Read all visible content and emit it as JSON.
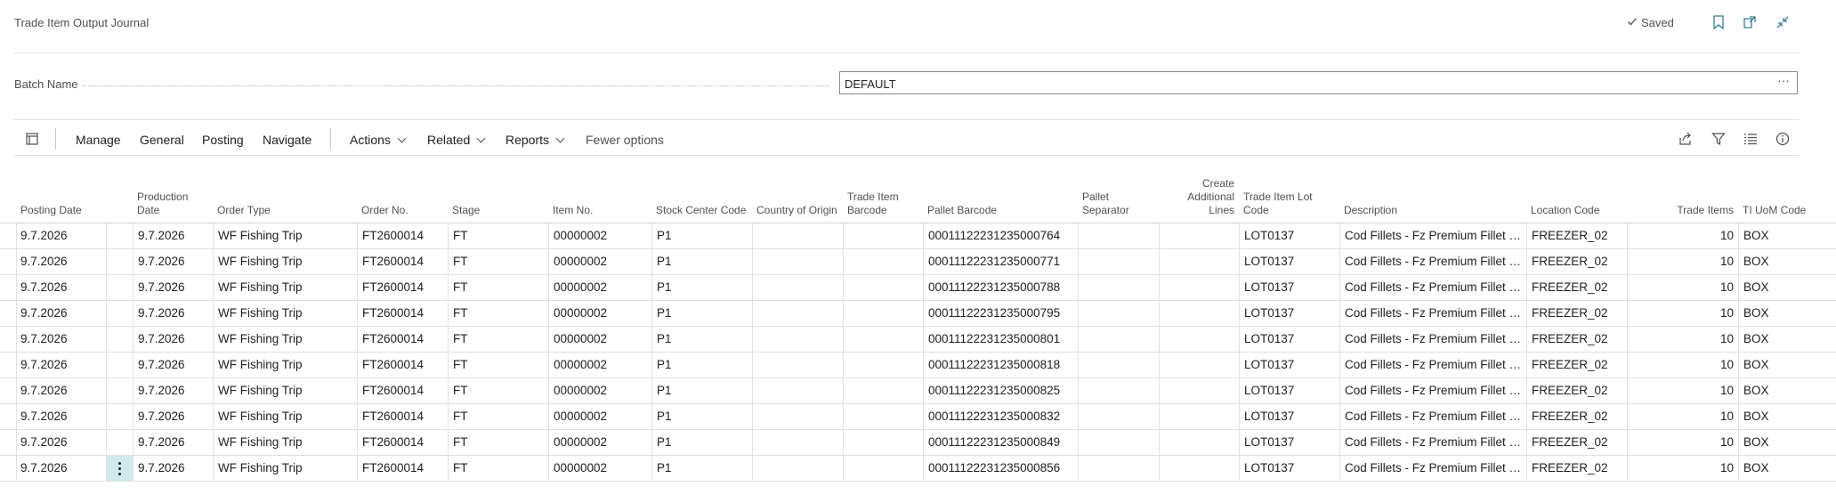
{
  "header": {
    "title": "Trade Item Output Journal",
    "saved_label": "Saved",
    "icons": [
      "checkmark-icon",
      "bookmark-icon",
      "open-in-new-window-icon",
      "collapse-icon"
    ]
  },
  "batch": {
    "label": "Batch Name",
    "value": "DEFAULT",
    "ellipsis": "···"
  },
  "toolbar": {
    "items": [
      "Manage",
      "General",
      "Posting",
      "Navigate"
    ],
    "actions": "Actions",
    "related": "Related",
    "reports": "Reports",
    "fewer_options": "Fewer options",
    "icons": [
      "list-view-icon",
      "share-icon",
      "filter-icon",
      "list-icon",
      "info-icon"
    ]
  },
  "columns": [
    "Posting Date",
    "Production Date",
    "Order Type",
    "Order No.",
    "Stage",
    "Item No.",
    "Stock Center Code",
    "Country of Origin",
    "Trade Item Barcode",
    "Pallet Barcode",
    "Pallet Separator",
    "Create Additional Lines",
    "Trade Item Lot Code",
    "Description",
    "Location Code",
    "Trade Items",
    "TI UoM Code"
  ],
  "rows": [
    [
      "9.7.2026",
      "9.7.2026",
      "WF Fishing Trip",
      "FT2600014",
      "FT",
      "00000002",
      "P1",
      "",
      "",
      "00011122231235000764",
      "",
      "",
      "LOT0137",
      "Cod Fillets - Fz Premium Fillet Pieces",
      "FREEZER_02",
      "10",
      "BOX"
    ],
    [
      "9.7.2026",
      "9.7.2026",
      "WF Fishing Trip",
      "FT2600014",
      "FT",
      "00000002",
      "P1",
      "",
      "",
      "00011122231235000771",
      "",
      "",
      "LOT0137",
      "Cod Fillets - Fz Premium Fillet Pieces",
      "FREEZER_02",
      "10",
      "BOX"
    ],
    [
      "9.7.2026",
      "9.7.2026",
      "WF Fishing Trip",
      "FT2600014",
      "FT",
      "00000002",
      "P1",
      "",
      "",
      "00011122231235000788",
      "",
      "",
      "LOT0137",
      "Cod Fillets - Fz Premium Fillet Pieces",
      "FREEZER_02",
      "10",
      "BOX"
    ],
    [
      "9.7.2026",
      "9.7.2026",
      "WF Fishing Trip",
      "FT2600014",
      "FT",
      "00000002",
      "P1",
      "",
      "",
      "00011122231235000795",
      "",
      "",
      "LOT0137",
      "Cod Fillets - Fz Premium Fillet Pieces",
      "FREEZER_02",
      "10",
      "BOX"
    ],
    [
      "9.7.2026",
      "9.7.2026",
      "WF Fishing Trip",
      "FT2600014",
      "FT",
      "00000002",
      "P1",
      "",
      "",
      "00011122231235000801",
      "",
      "",
      "LOT0137",
      "Cod Fillets - Fz Premium Fillet Pieces",
      "FREEZER_02",
      "10",
      "BOX"
    ],
    [
      "9.7.2026",
      "9.7.2026",
      "WF Fishing Trip",
      "FT2600014",
      "FT",
      "00000002",
      "P1",
      "",
      "",
      "00011122231235000818",
      "",
      "",
      "LOT0137",
      "Cod Fillets - Fz Premium Fillet Pieces",
      "FREEZER_02",
      "10",
      "BOX"
    ],
    [
      "9.7.2026",
      "9.7.2026",
      "WF Fishing Trip",
      "FT2600014",
      "FT",
      "00000002",
      "P1",
      "",
      "",
      "00011122231235000825",
      "",
      "",
      "LOT0137",
      "Cod Fillets - Fz Premium Fillet Pieces",
      "FREEZER_02",
      "10",
      "BOX"
    ],
    [
      "9.7.2026",
      "9.7.2026",
      "WF Fishing Trip",
      "FT2600014",
      "FT",
      "00000002",
      "P1",
      "",
      "",
      "00011122231235000832",
      "",
      "",
      "LOT0137",
      "Cod Fillets - Fz Premium Fillet Pieces",
      "FREEZER_02",
      "10",
      "BOX"
    ],
    [
      "9.7.2026",
      "9.7.2026",
      "WF Fishing Trip",
      "FT2600014",
      "FT",
      "00000002",
      "P1",
      "",
      "",
      "00011122231235000849",
      "",
      "",
      "LOT0137",
      "Cod Fillets - Fz Premium Fillet Pieces",
      "FREEZER_02",
      "10",
      "BOX"
    ],
    [
      "9.7.2026",
      "9.7.2026",
      "WF Fishing Trip",
      "FT2600014",
      "FT",
      "00000002",
      "P1",
      "",
      "",
      "00011122231235000856",
      "",
      "",
      "LOT0137",
      "Cod Fillets - Fz Premium Fillet Pieces",
      "FREEZER_02",
      "10",
      "BOX"
    ]
  ],
  "active_row": 9,
  "colors": {
    "accent": "#cfe9ef",
    "border": "#e1e1e1",
    "text": "#212121",
    "muted": "#505050"
  }
}
